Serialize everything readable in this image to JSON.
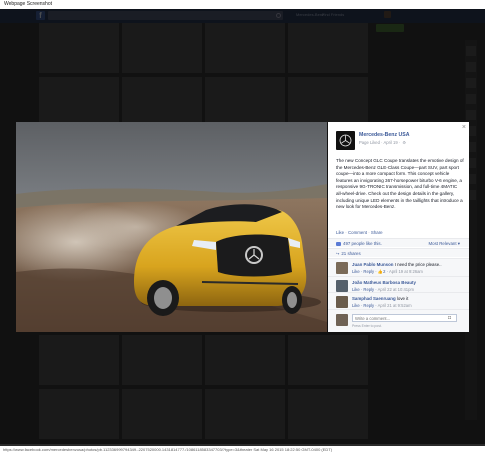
{
  "window": {
    "title": "Webpage Screenshot"
  },
  "fbbar": {
    "logo": "f",
    "nav_home": "Mercedes-Benz",
    "nav_find": "Find Friends"
  },
  "status_bar": {
    "text": "https://www.facebook.com/mercedesbenzusa/photos/pb.112336999794349.-2207520000.1431814777./1086118583347703/?type=3&theater Sat May 16 2015 18:22:50 GMT-0400 (EDT)"
  },
  "post": {
    "page_name": "Mercedes-Benz USA",
    "meta": "Page Liked · April 19 ·",
    "text": "The new Concept GLC Coupe translates the emotive design of the Mercedes-Benz GLE-Class Coupe—part SUV, part sport coupe—into a more compact form. This concept vehicle features an invigorating 367-horsepower biturbo V-6 engine, a responsive 9G-TRONIC transmission, and full-time 4MATIC all-wheel-drive. Check out the design details in the gallery, including unique LED elements in the taillights that introduce a new look for Mercedes-Benz.",
    "actions": {
      "like": "Like",
      "comment": "Comment",
      "share": "Share",
      "sep": " · "
    },
    "likes": "497 people like this.",
    "most_relevant": "Most Relevant ▾",
    "shares": "21 shares"
  },
  "comments": [
    {
      "author": "Juan Pablo Munson",
      "text": " I need the price please..",
      "like": "Like",
      "reply": "Reply",
      "likes_count": "2",
      "time": "April 19 at 9:26am"
    },
    {
      "author": "João Matheus Barbosa Beauty",
      "text": "",
      "like": "Like",
      "reply": "Reply",
      "likes_count": "",
      "time": "April 22 at 10:41pm"
    },
    {
      "author": "Samphad Saenruang",
      "text": " love it",
      "like": "Like",
      "reply": "Reply",
      "likes_count": "",
      "time": "April 21 at 9:52am"
    }
  ],
  "composer": {
    "placeholder": "Write a comment...",
    "hint": "Press Enter to post."
  },
  "icons": {
    "close": "×",
    "gear": "⚙",
    "share": "↪",
    "camera": "◘"
  },
  "colors": {
    "fb_blue": "#3b5998",
    "car_yellow": "#d8a41e"
  }
}
